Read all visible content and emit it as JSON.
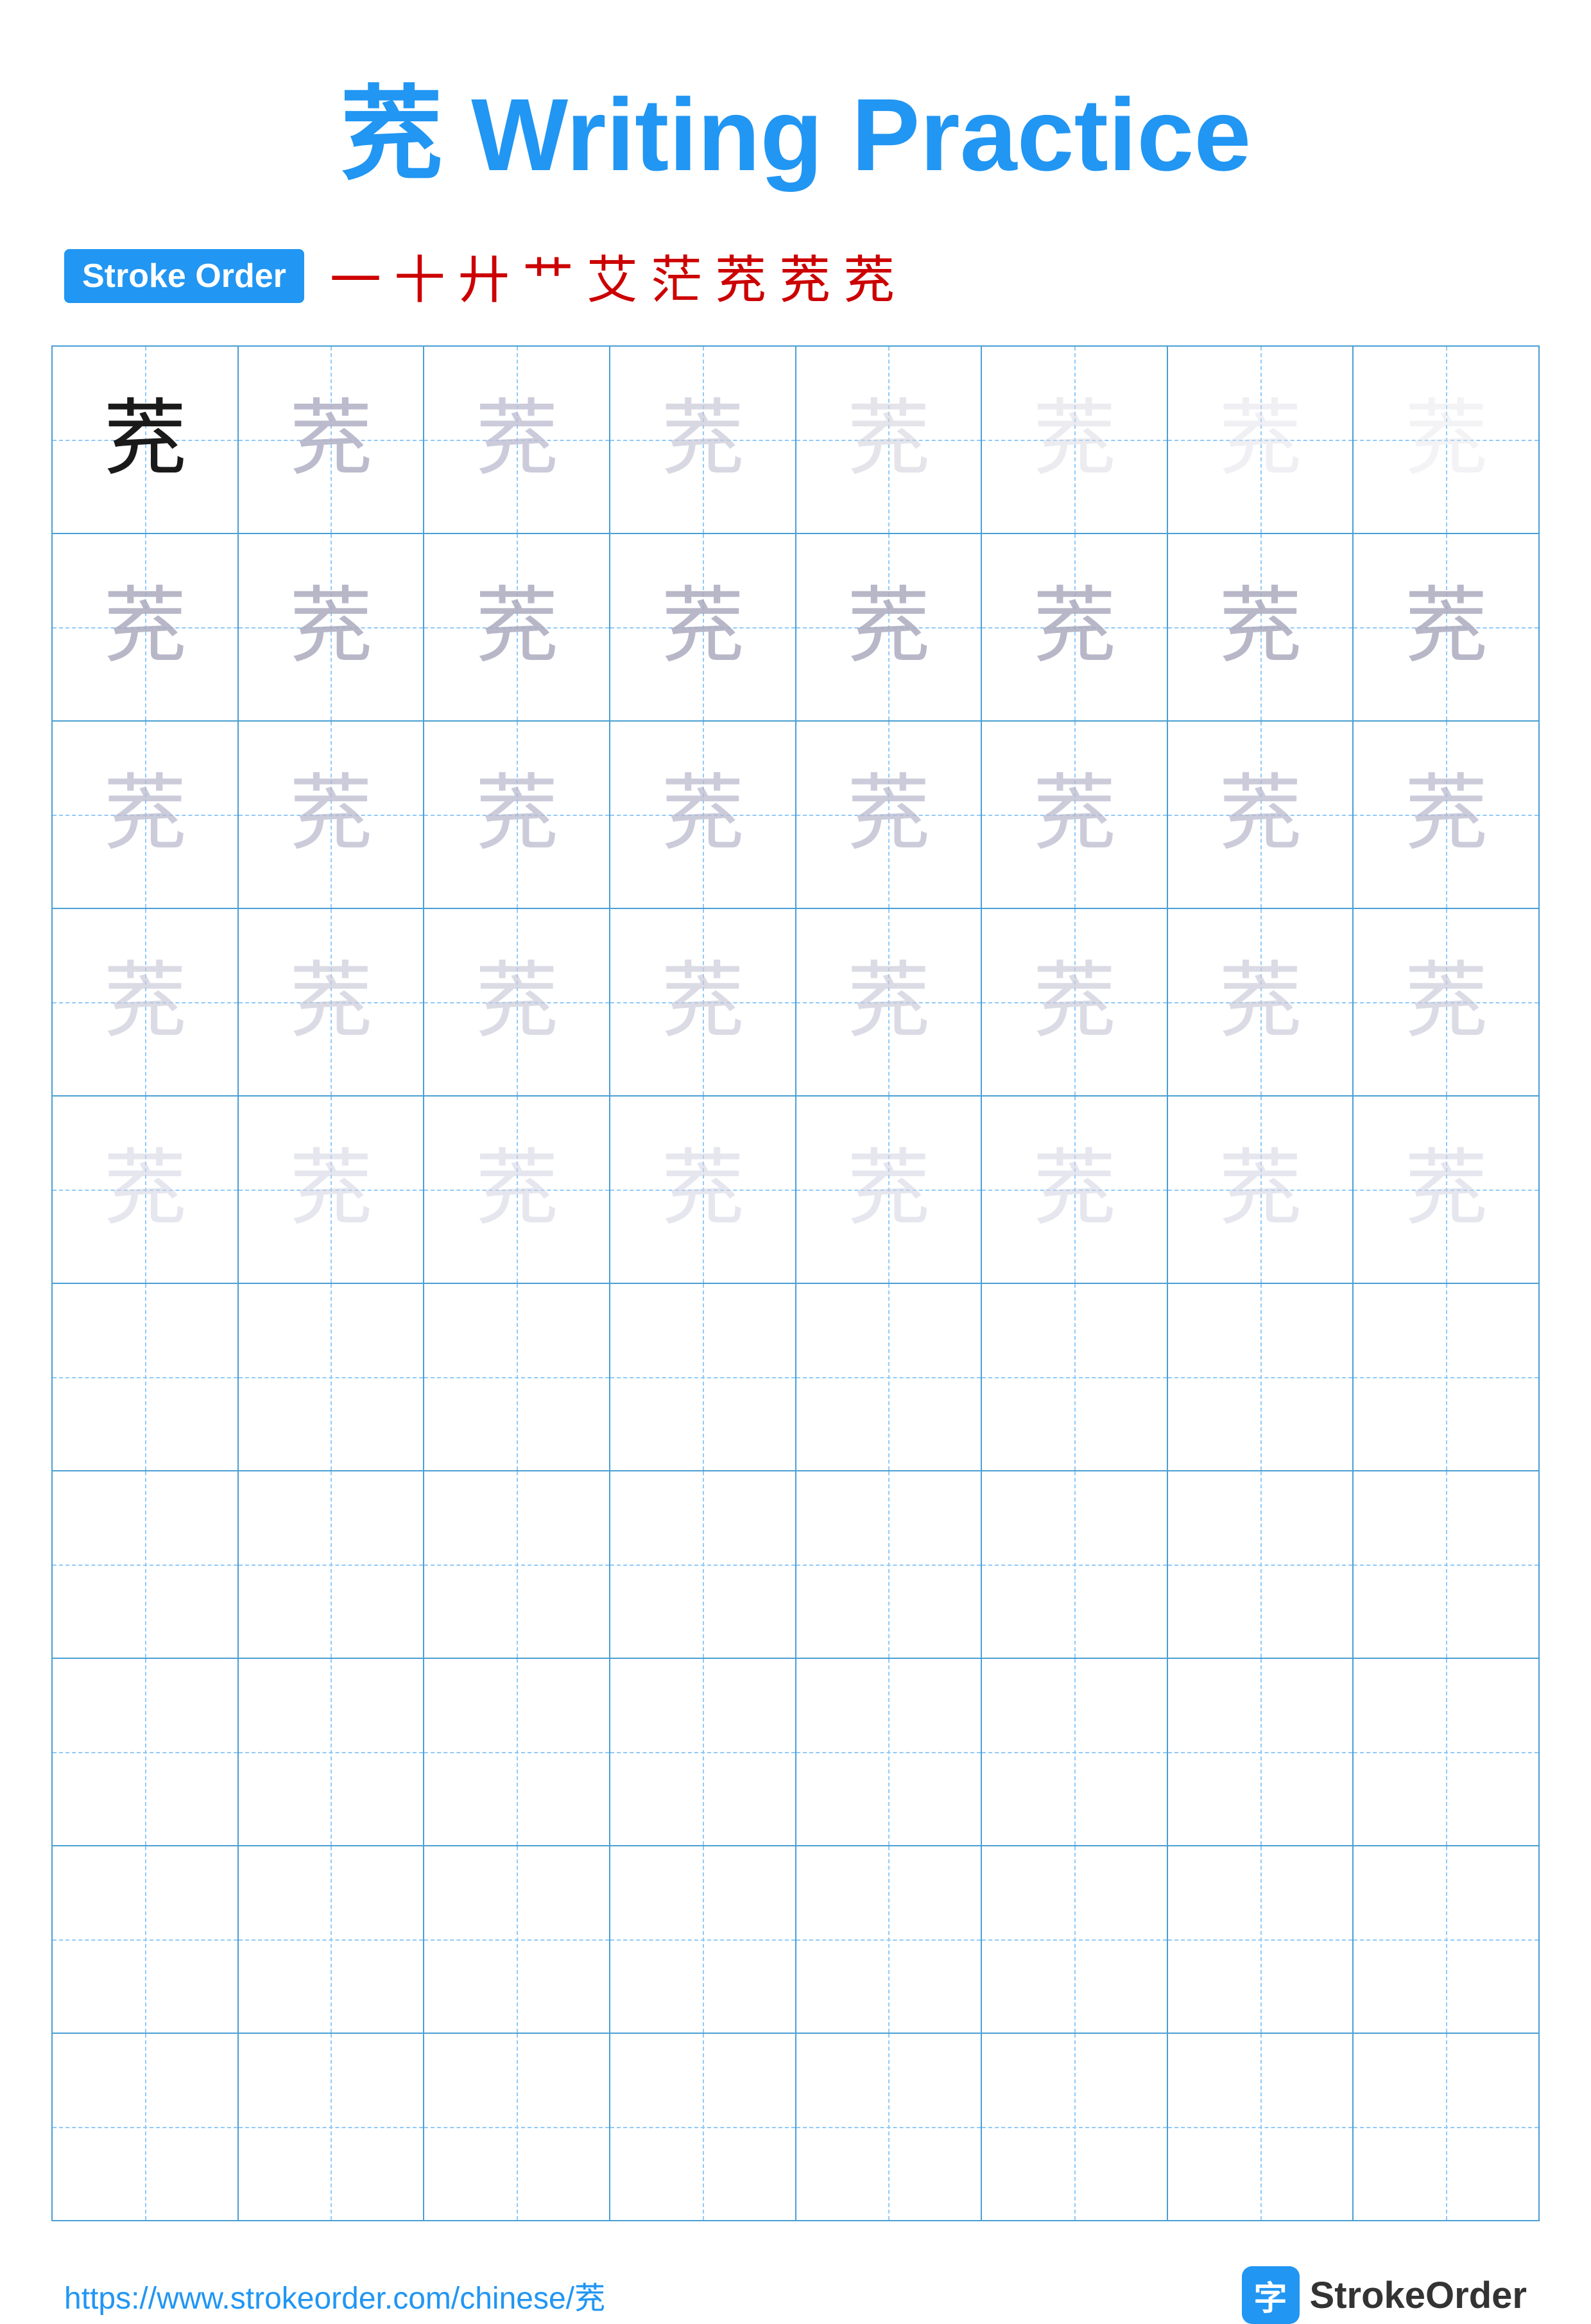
{
  "title": {
    "character": "茺",
    "label": "Writing Practice",
    "full": "茺 Writing Practice"
  },
  "stroke_order": {
    "badge_label": "Stroke Order",
    "strokes": [
      "一",
      "十",
      "廾",
      "艹",
      "艾",
      "茫",
      "茺",
      "茺",
      "茺"
    ]
  },
  "character": "茺",
  "grid": {
    "rows": 10,
    "cols": 8
  },
  "footer": {
    "url": "https://www.strokeorder.com/chinese/茺",
    "logo_char": "字",
    "logo_name": "StrokeOrder"
  }
}
